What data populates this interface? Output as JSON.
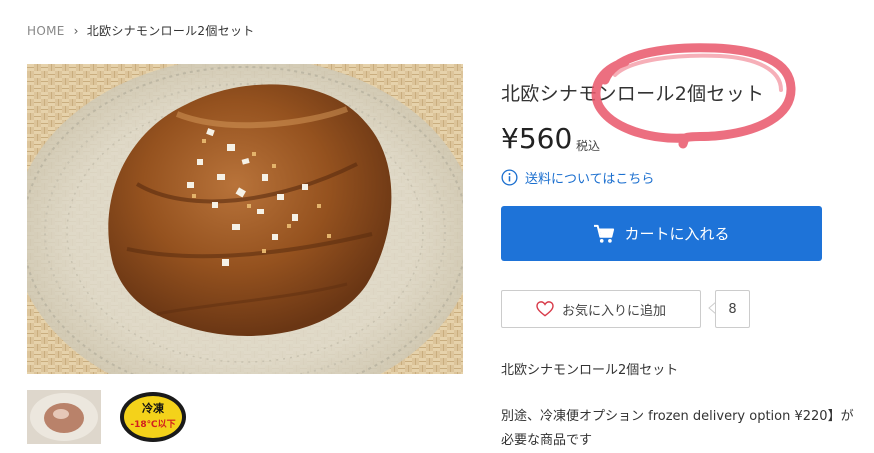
{
  "breadcrumb": {
    "home": "HOME",
    "separator": "›",
    "current": "北欧シナモンロール2個セット"
  },
  "product": {
    "title": "北欧シナモンロール2個セット",
    "price": "¥560",
    "tax_label": "税込",
    "shipping_link": "送料についてはこちら",
    "cart_button": "カートに入れる",
    "favorite_button": "お気に入りに追加",
    "favorite_count": "8",
    "description_title": "北欧シナモンロール2個セット",
    "description_body": "別途、冷凍便オプション frozen delivery option ¥220】が必要な商品です"
  },
  "thumbnail_badge": {
    "top": "冷凍",
    "temp": "-18℃以下"
  },
  "colors": {
    "accent": "#1e73d8",
    "link": "#1b6fcf",
    "annotation": "#e9566a"
  }
}
